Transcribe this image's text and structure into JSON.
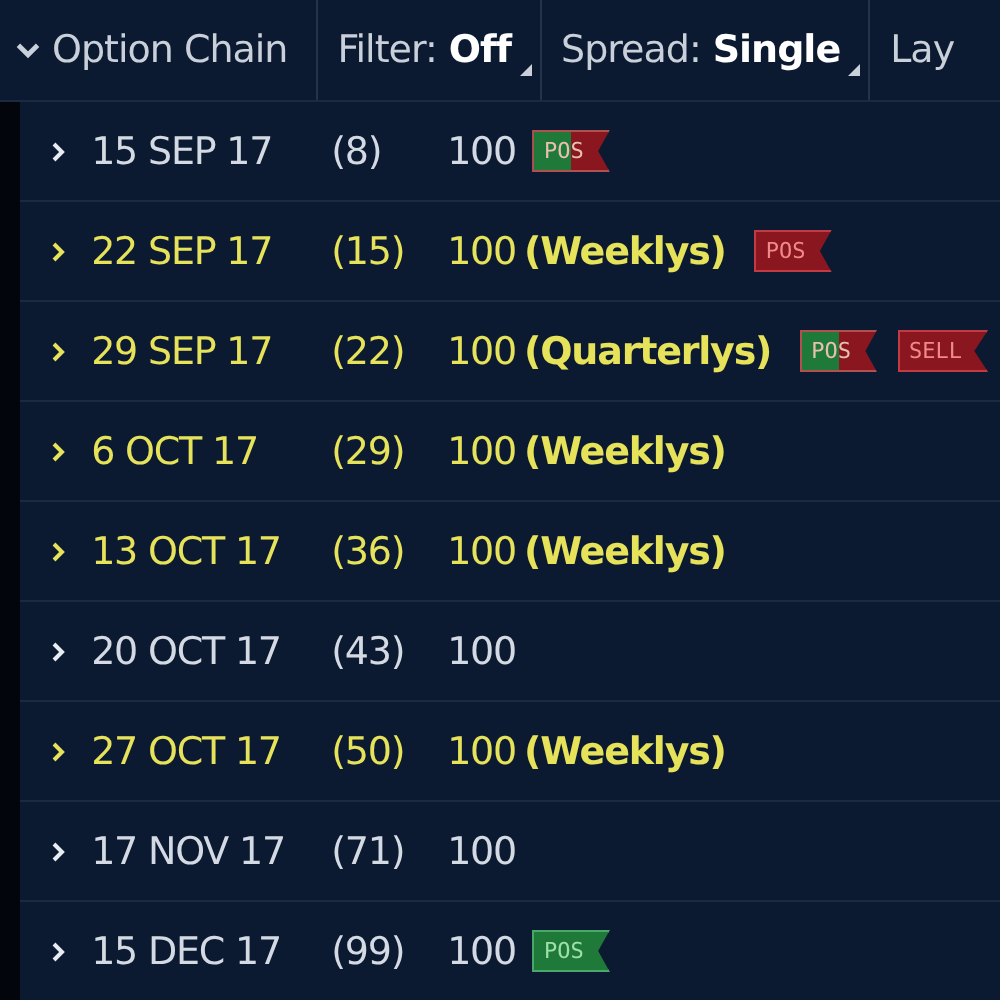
{
  "header": {
    "title": "Option Chain",
    "expanded": true,
    "filter": {
      "label": "Filter:",
      "value": "Off"
    },
    "spread": {
      "label": "Spread:",
      "value": "Single"
    },
    "cut_label": "Lay"
  },
  "rows": [
    {
      "expiry": "15 SEP 17",
      "days": "(8)",
      "multiplier": "100",
      "highlighted": false,
      "expanded": false,
      "badges": [
        {
          "text": "POS",
          "kind": "mixed"
        }
      ]
    },
    {
      "expiry": "22 SEP 17",
      "days": "(15)",
      "multiplier": "100",
      "series": "(Weeklys)",
      "highlighted": true,
      "expanded": false,
      "badges": [
        {
          "text": "POS",
          "kind": "short"
        }
      ]
    },
    {
      "expiry": "29 SEP 17",
      "days": "(22)",
      "multiplier": "100",
      "series": "(Quarterlys)",
      "highlighted": true,
      "expanded": false,
      "badges": [
        {
          "text": "POS",
          "kind": "mixed"
        },
        {
          "text": "SELL",
          "kind": "short"
        }
      ]
    },
    {
      "expiry": "6 OCT 17",
      "days": "(29)",
      "multiplier": "100",
      "series": "(Weeklys)",
      "highlighted": true,
      "expanded": false
    },
    {
      "expiry": "13 OCT 17",
      "days": "(36)",
      "multiplier": "100",
      "series": "(Weeklys)",
      "highlighted": true,
      "expanded": false
    },
    {
      "expiry": "20 OCT 17",
      "days": "(43)",
      "multiplier": "100",
      "highlighted": false,
      "expanded": false
    },
    {
      "expiry": "27 OCT 17",
      "days": "(50)",
      "multiplier": "100",
      "series": "(Weeklys)",
      "highlighted": true,
      "expanded": false
    },
    {
      "expiry": "17 NOV 17",
      "days": "(71)",
      "multiplier": "100",
      "highlighted": false,
      "expanded": false
    },
    {
      "expiry": "15 DEC 17",
      "days": "(99)",
      "multiplier": "100",
      "highlighted": false,
      "expanded": false,
      "badges": [
        {
          "text": "POS",
          "kind": "long"
        }
      ]
    }
  ]
}
